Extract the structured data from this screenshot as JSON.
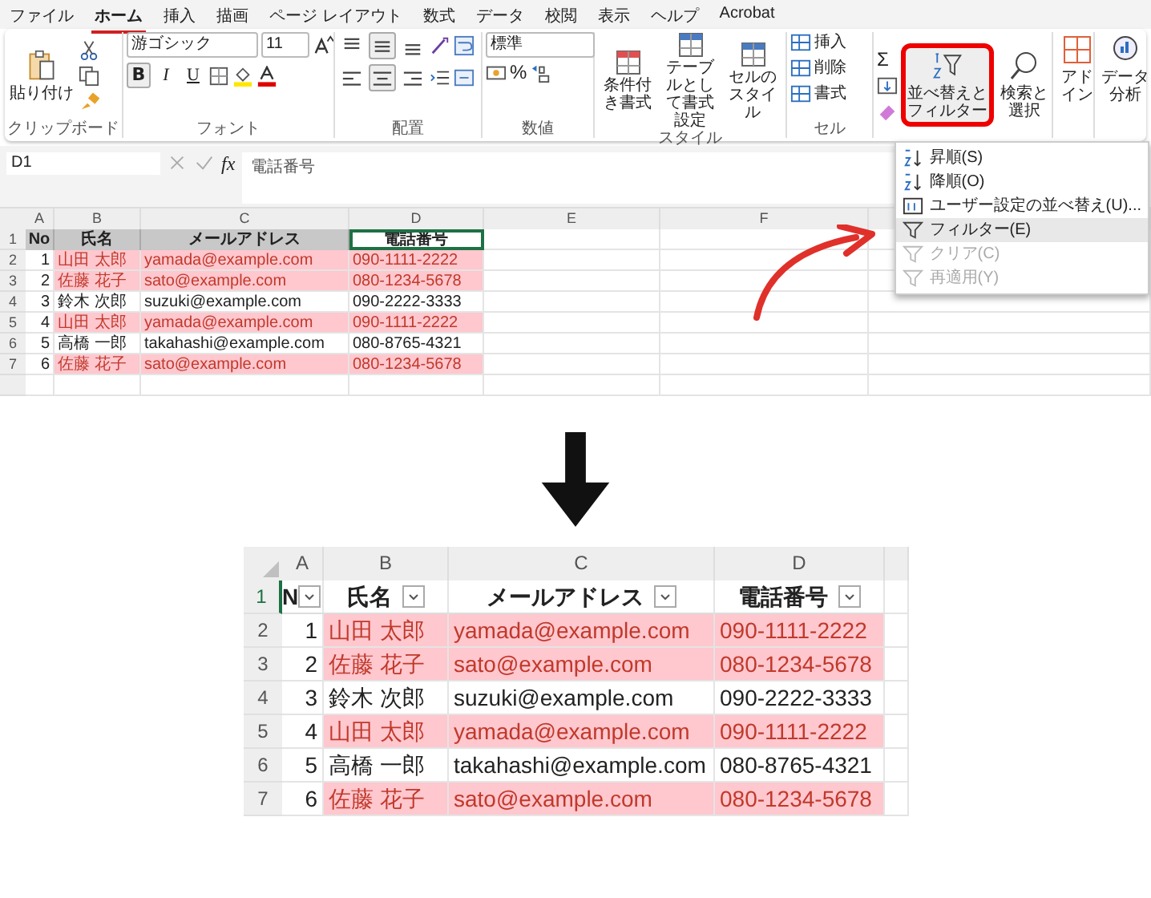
{
  "menu_tabs": [
    {
      "label": "ファイル",
      "selected": false
    },
    {
      "label": "ホーム",
      "selected": true
    },
    {
      "label": "挿入",
      "selected": false
    },
    {
      "label": "描画",
      "selected": false
    },
    {
      "label": "ページ レイアウト",
      "selected": false
    },
    {
      "label": "数式",
      "selected": false
    },
    {
      "label": "データ",
      "selected": false
    },
    {
      "label": "校閲",
      "selected": false
    },
    {
      "label": "表示",
      "selected": false
    },
    {
      "label": "ヘルプ",
      "selected": false
    },
    {
      "label": "Acrobat",
      "selected": false
    }
  ],
  "ribbon": {
    "clipboard": {
      "paste": "貼り付け",
      "label": "クリップボード"
    },
    "font": {
      "font_name": "游ゴシック",
      "font_size": "11",
      "format_buttons": [
        {
          "label": "B",
          "kind": "bold",
          "selected": true
        },
        {
          "label": "I",
          "kind": "italic",
          "selected": false
        },
        {
          "label": "U",
          "kind": "underline",
          "selected": false
        }
      ],
      "label": "フォント"
    },
    "alignment": {
      "vertical": [
        {
          "kind": "top",
          "selected": false
        },
        {
          "kind": "middle",
          "selected": true
        },
        {
          "kind": "bottom",
          "selected": false
        }
      ],
      "horizontal": [
        {
          "kind": "left",
          "selected": false
        },
        {
          "kind": "center",
          "selected": true
        },
        {
          "kind": "right",
          "selected": false
        }
      ],
      "label": "配置"
    },
    "number": {
      "format": "標準",
      "percent": "%",
      "label": "数値"
    },
    "styles": {
      "buttons": [
        "条件付き書式",
        "テーブルとして書式設定",
        "セルのスタイル"
      ],
      "label": "スタイル"
    },
    "cells": {
      "buttons": [
        "挿入",
        "削除",
        "書式"
      ],
      "label": "セル"
    },
    "editing": {
      "sum": "Σ",
      "sort_filter": {
        "label": "並べ替えとフィルター",
        "highlighted": true
      },
      "find": "検索と選択"
    },
    "addins": "アドイン",
    "analysis": "データ分析"
  },
  "sort_menu": [
    {
      "label": "昇順(S)",
      "kind": "ascending",
      "disabled": false,
      "selected": false
    },
    {
      "label": "降順(O)",
      "kind": "descending",
      "disabled": false,
      "selected": false
    },
    {
      "label": "ユーザー設定の並べ替え(U)...",
      "kind": "custom",
      "disabled": false,
      "selected": false
    },
    {
      "label": "フィルター(E)",
      "kind": "filter",
      "disabled": false,
      "selected": true
    },
    {
      "label": "クリア(C)",
      "kind": "clear",
      "disabled": true,
      "selected": false
    },
    {
      "label": "再適用(Y)",
      "kind": "reapply",
      "disabled": true,
      "selected": false
    }
  ],
  "formula_bar": {
    "name_box": "D1",
    "function_label": "fx",
    "formula": "電話番号"
  },
  "sheet_before": {
    "columns": [
      "A",
      "B",
      "C",
      "D",
      "E",
      "F"
    ],
    "header_row": "1",
    "header": [
      {
        "text": "No",
        "selected": false
      },
      {
        "text": "氏名",
        "selected": false
      },
      {
        "text": "メールアドレス",
        "selected": false
      },
      {
        "text": "電話番号",
        "selected": true
      }
    ],
    "rows": [
      {
        "row": "2",
        "no": "1",
        "name": "山田 太郎",
        "email": "yamada@example.com",
        "phone": "090-1111-2222",
        "highlighted": true
      },
      {
        "row": "3",
        "no": "2",
        "name": "佐藤 花子",
        "email": "sato@example.com",
        "phone": "080-1234-5678",
        "highlighted": true
      },
      {
        "row": "4",
        "no": "3",
        "name": "鈴木 次郎",
        "email": "suzuki@example.com",
        "phone": "090-2222-3333",
        "highlighted": false
      },
      {
        "row": "5",
        "no": "4",
        "name": "山田 太郎",
        "email": "yamada@example.com",
        "phone": "090-1111-2222",
        "highlighted": true
      },
      {
        "row": "6",
        "no": "5",
        "name": "高橋 一郎",
        "email": "takahashi@example.com",
        "phone": "080-8765-4321",
        "highlighted": false
      },
      {
        "row": "7",
        "no": "6",
        "name": "佐藤 花子",
        "email": "sato@example.com",
        "phone": "080-1234-5678",
        "highlighted": true
      }
    ]
  },
  "sheet_after": {
    "columns": [
      "A",
      "B",
      "C",
      "D"
    ],
    "header_row": "1",
    "filter_buttons": true,
    "header": [
      "N",
      "氏名",
      "メールアドレス",
      "電話番号"
    ],
    "rows": [
      {
        "row": "2",
        "no": "1",
        "name": "山田 太郎",
        "email": "yamada@example.com",
        "phone": "090-1111-2222",
        "highlighted": true
      },
      {
        "row": "3",
        "no": "2",
        "name": "佐藤 花子",
        "email": "sato@example.com",
        "phone": "080-1234-5678",
        "highlighted": true
      },
      {
        "row": "4",
        "no": "3",
        "name": "鈴木 次郎",
        "email": "suzuki@example.com",
        "phone": "090-2222-3333",
        "highlighted": false
      },
      {
        "row": "5",
        "no": "4",
        "name": "山田 太郎",
        "email": "yamada@example.com",
        "phone": "090-1111-2222",
        "highlighted": true
      },
      {
        "row": "6",
        "no": "5",
        "name": "高橋 一郎",
        "email": "takahashi@example.com",
        "phone": "080-8765-4321",
        "highlighted": false
      },
      {
        "row": "7",
        "no": "6",
        "name": "佐藤 花子",
        "email": "sato@example.com",
        "phone": "080-1234-5678",
        "highlighted": true
      }
    ]
  }
}
